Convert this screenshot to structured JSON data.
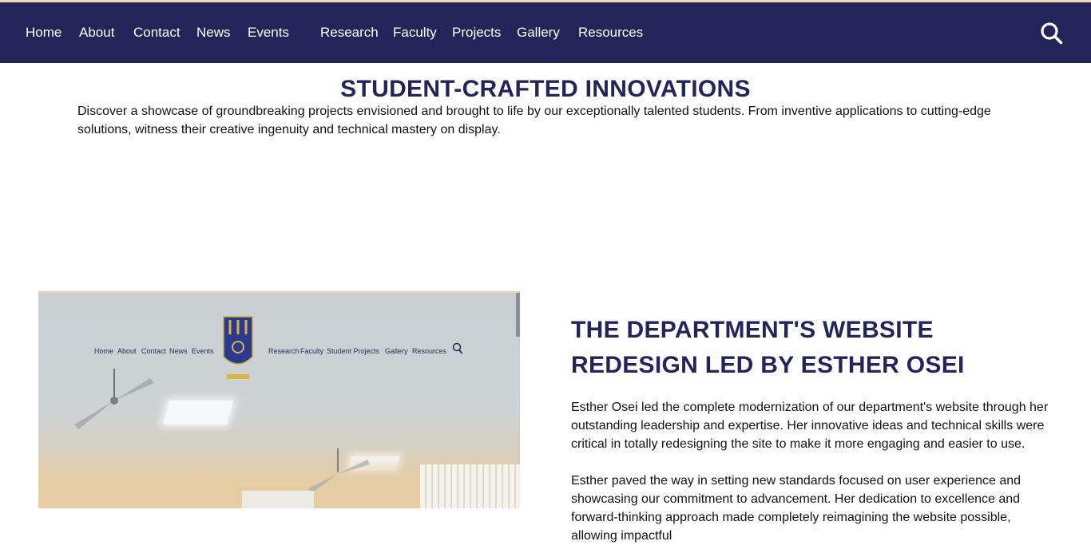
{
  "nav": {
    "items": [
      "Home",
      "About",
      "Contact",
      "News",
      "Events",
      "Research",
      "Faculty",
      "Projects",
      "Gallery",
      "Resources"
    ]
  },
  "section": {
    "title": "STUDENT-CRAFTED INNOVATIONS",
    "intro": "Discover a showcase of groundbreaking projects envisioned and brought to life by our exceptionally talented students. From inventive applications to cutting-edge solutions, witness their creative ingenuity and technical mastery on display."
  },
  "photo": {
    "mini_nav": [
      "Home",
      "About",
      "Contact",
      "News",
      "Events",
      "Research",
      "Faculty",
      "Student Projects",
      "Gallery",
      "Resources"
    ]
  },
  "article": {
    "title": "THE DEPARTMENT'S WEBSITE REDESIGN LED BY ESTHER OSEI",
    "p1": "Esther Osei led the complete modernization of our department's website through her outstanding leadership and expertise. Her innovative ideas and technical skills were critical in totally redesigning the site to make it more engaging and easier to use.",
    "p2": "Esther paved the way in setting new standards focused on user experience and showcasing our commitment to advancement. Her dedication to excellence and forward-thinking approach made completely reimagining the website possible, allowing impactful"
  },
  "colors": {
    "navy": "#23245a",
    "accent": "#f3d9b8"
  },
  "icons": {
    "search": "search-icon",
    "mini_search": "search-icon",
    "crest": "crest-icon"
  }
}
